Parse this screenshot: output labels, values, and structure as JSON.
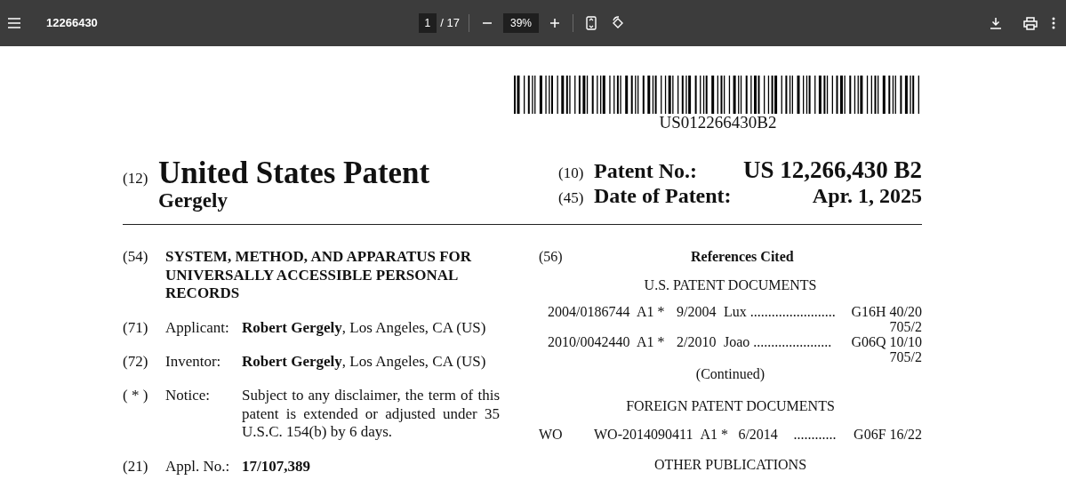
{
  "toolbar": {
    "title": "12266430",
    "page_current": "1",
    "page_total": "/ 17",
    "zoom": "39%"
  },
  "document": {
    "barcode_text": "US012266430B2",
    "header_left": {
      "code": "(12)",
      "title": "United States Patent",
      "inventor": "Gergely"
    },
    "header_right": [
      {
        "code": "(10)",
        "label": "Patent No.:",
        "value": "US 12,266,430 B2"
      },
      {
        "code": "(45)",
        "label": "Date of Patent:",
        "value": "Apr. 1, 2025"
      }
    ],
    "left_fields": [
      {
        "kind": "title",
        "code": "(54)",
        "text": "SYSTEM, METHOD, AND APPARATUS FOR UNIVERSALLY ACCESSIBLE PERSONAL RECORDS"
      },
      {
        "kind": "field",
        "code": "(71)",
        "label": "Applicant:",
        "value": "**Robert Gergely**, Los Angeles, CA (US)",
        "value_bold": false
      },
      {
        "kind": "field",
        "code": "(72)",
        "label": "Inventor:",
        "value": "**Robert Gergely**, Los Angeles, CA (US)",
        "value_bold": false
      },
      {
        "kind": "notice",
        "code": "( * )",
        "label": "Notice:",
        "value": "Subject to any disclaimer, the term of this patent is extended or adjusted under 35 U.S.C. 154(b) by 6 days.",
        "value_bold": false
      },
      {
        "kind": "field",
        "code": "(21)",
        "label": "Appl. No.:",
        "value": "17/107,389",
        "value_bold": true
      }
    ],
    "references": {
      "code": "(56)",
      "heading": "References Cited",
      "us_heading": "U.S. PATENT DOCUMENTS",
      "us_docs": [
        {
          "number": "2004/0186744",
          "kind": "A1 *",
          "date": "9/2004",
          "name": "Lux",
          "leader": "........................",
          "class": "G16H 40/20",
          "extra": "705/2"
        },
        {
          "number": "2010/0042440",
          "kind": "A1 *",
          "date": "2/2010",
          "name": "Joao",
          "leader": "......................",
          "class": "G06Q 10/10",
          "extra": "705/2"
        }
      ],
      "continued": "(Continued)",
      "foreign_heading": "FOREIGN PATENT DOCUMENTS",
      "foreign_docs": [
        {
          "country": "WO",
          "number": "WO-2014090411",
          "kind": "A1 *",
          "date": "6/2014",
          "leader": "............",
          "class": "G06F 16/22"
        }
      ],
      "other_heading": "OTHER PUBLICATIONS"
    }
  }
}
